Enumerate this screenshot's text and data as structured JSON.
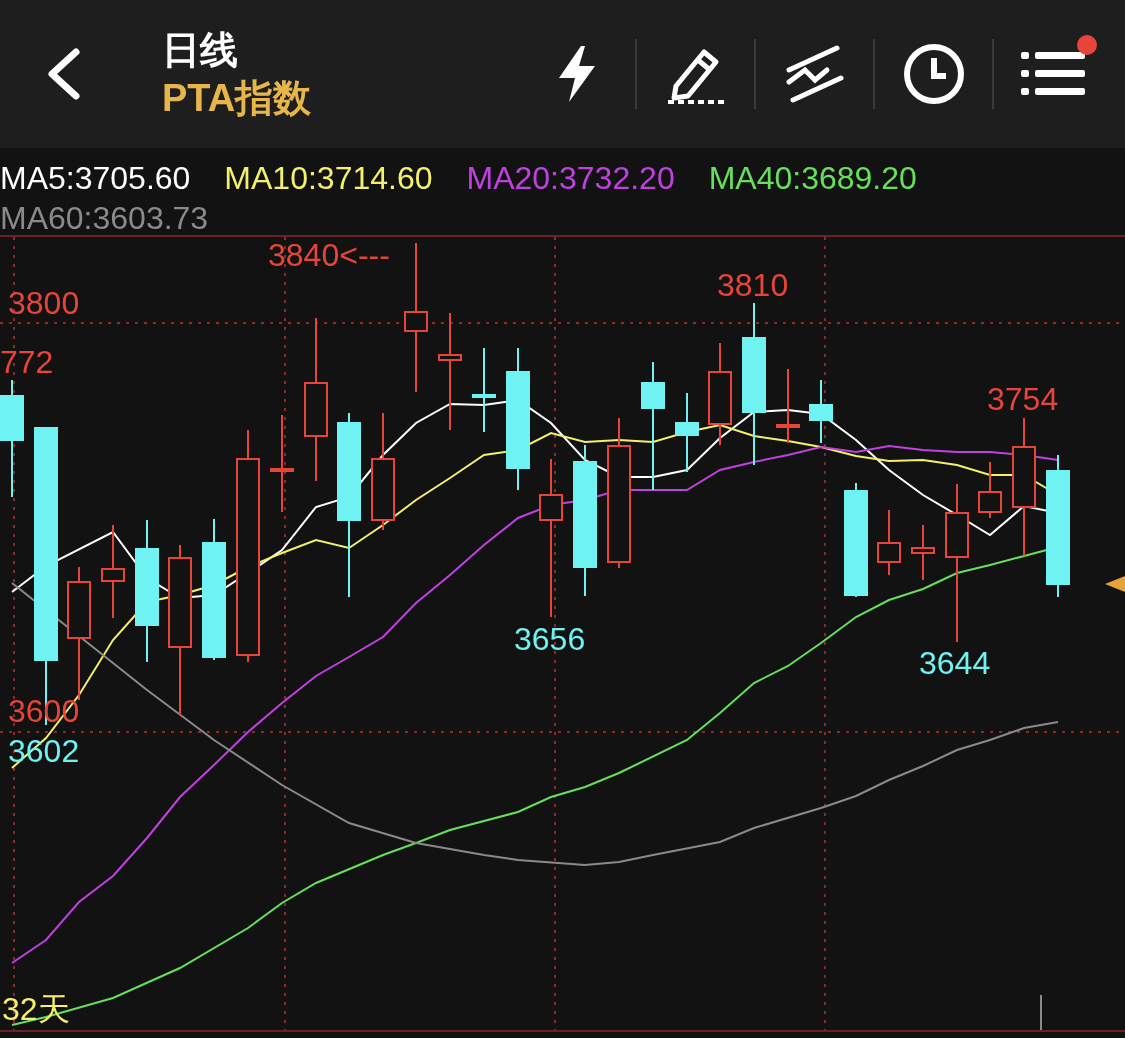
{
  "header": {
    "title": "日线",
    "subtitle": "PTA指数"
  },
  "toolbar": [
    {
      "kind": "flash"
    },
    {
      "kind": "draw"
    },
    {
      "kind": "trend"
    },
    {
      "kind": "clock"
    },
    {
      "kind": "menu",
      "badge": true
    }
  ],
  "ma_legend": [
    {
      "text": "MA5:3705.60",
      "color": "#ffffff"
    },
    {
      "text": "MA10:3714.60",
      "color": "#f5f06a"
    },
    {
      "text": "MA20:3732.20",
      "color": "#c040e0"
    },
    {
      "text": "MA40:3689.20",
      "color": "#66e05a"
    },
    {
      "text": "MA60:3603.73",
      "color": "#8a8a8a"
    }
  ],
  "chart_labels": [
    {
      "text": "3840<---",
      "kind": "high"
    },
    {
      "text": "3800",
      "kind": "high"
    },
    {
      "text": "772",
      "kind": "high"
    },
    {
      "text": "3810",
      "kind": "high"
    },
    {
      "text": "3754",
      "kind": "high"
    },
    {
      "text": "3656",
      "kind": "low"
    },
    {
      "text": "3644",
      "kind": "low"
    },
    {
      "text": "3600",
      "kind": "high"
    },
    {
      "text": "3602",
      "kind": "low"
    },
    {
      "text": "32天",
      "kind": "days"
    }
  ]
}
